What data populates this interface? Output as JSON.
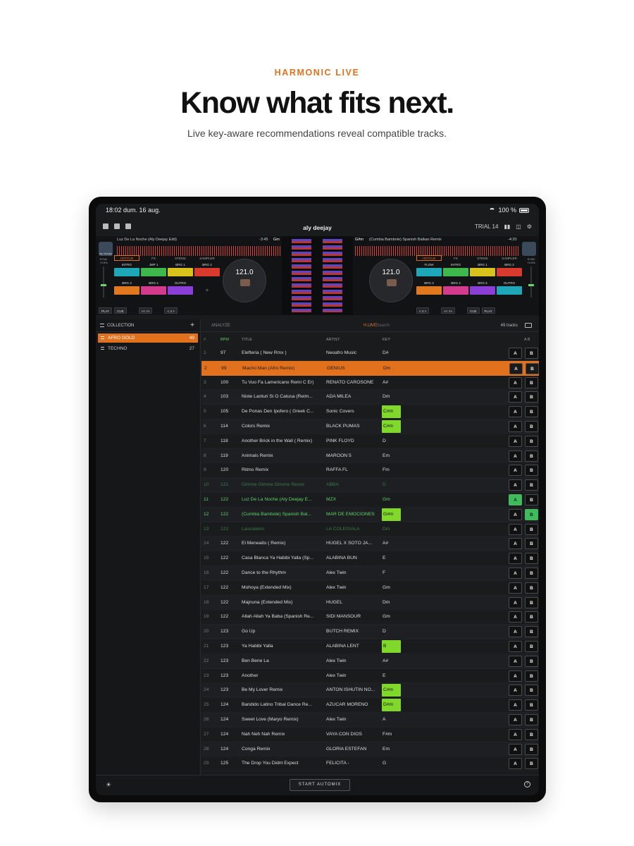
{
  "hero": {
    "eyebrow": "HARMONIC LIVE",
    "headline": "Know what fits next.",
    "subtitle": "Live key-aware recommendations reveal compatible tracks."
  },
  "status": {
    "time": "18:02",
    "date": "dum. 16 aug.",
    "battery": "100 %"
  },
  "app": {
    "logo": "aly deejay",
    "trial": "TRIAL 14"
  },
  "deck_left": {
    "track": "Luz De La Noche (Aly Deejay Edit)",
    "time": "-3:45",
    "key": "Gm",
    "bpm": "121.0",
    "pitch": "+0.0%",
    "tabs": [
      "HOTCUE",
      "FX",
      "STEMS",
      "SAMPLER"
    ],
    "pads": [
      {
        "label": "INTRO",
        "color": "#1ea7b8"
      },
      {
        "label": "JMP 1",
        "color": "#3fb84b"
      },
      {
        "label": "BRG 1",
        "color": "#d9c21c"
      },
      {
        "label": "BRG 2",
        "color": "#d93a2e"
      },
      {
        "label": "BRG 3",
        "color": "#e2781d"
      },
      {
        "label": "BRG 4",
        "color": "#d43a8d"
      },
      {
        "label": "OUTRO",
        "color": "#8b3fd6"
      }
    ],
    "controls": [
      "PLAY",
      "CUE",
      "<< >>",
      "< 4 >"
    ]
  },
  "deck_right": {
    "track": "(Cumbia Bambole) Spanish Balkan Remix",
    "time": "-4:20",
    "key": "G#m",
    "bpm": "121.0",
    "pitch": "+0.0%",
    "tabs": [
      "HOTCUE",
      "FX",
      "STEMS",
      "SAMPLER"
    ],
    "pads": [
      {
        "label": "FLOW",
        "color": "#1ea7b8"
      },
      {
        "label": "INTRO",
        "color": "#3fb84b"
      },
      {
        "label": "BRG 1",
        "color": "#d9c21c"
      },
      {
        "label": "BRG 2",
        "color": "#d93a2e"
      },
      {
        "label": "BRG 3",
        "color": "#e2781d"
      },
      {
        "label": "BRG 4",
        "color": "#d43a8d"
      },
      {
        "label": "BRG 5",
        "color": "#8b3fd6"
      },
      {
        "label": "OUTRO",
        "color": "#1ea7b8"
      }
    ],
    "controls": [
      "< 4 >",
      "<< >>",
      "CUE",
      "PLAY"
    ]
  },
  "sidebar": {
    "header": "COLLECTION",
    "crates": [
      {
        "name": "AFRO GOLD",
        "count": "49",
        "selected": true
      },
      {
        "name": "TECHNO",
        "count": "27",
        "selected": false
      }
    ]
  },
  "toolbar": {
    "analyze": "ANALYZE",
    "hlive": "H.LIVE",
    "search_placeholder": "Search",
    "count": "49 tracks"
  },
  "columns": {
    "num": "#",
    "bpm": "BPM",
    "title": "TITLE",
    "artist": "ARTIST",
    "key": "KEY",
    "ab": "A B"
  },
  "tracks": [
    {
      "n": "1",
      "bpm": "97",
      "title": "Elefteria ( New Rmx )",
      "artist": "Neoafro Music",
      "key": "D#"
    },
    {
      "n": "2",
      "bpm": "99",
      "title": "Macho Man (Afro Remix)",
      "artist": "GENIUS",
      "key": "Dm",
      "state": "sel"
    },
    {
      "n": "3",
      "bpm": "100",
      "title": "Tu Vuo Fa Lamericano Remi C Er)",
      "artist": "RENATO CAROSONE",
      "key": "A#"
    },
    {
      "n": "4",
      "bpm": "103",
      "title": "Niste Lanturi Si O Catusa (Reim...",
      "artist": "ADA MILEA",
      "key": "Dm"
    },
    {
      "n": "5",
      "bpm": "105",
      "title": "De Ponas Den Ipofero ( Greek C...",
      "artist": "Sonic Covers",
      "key": "C#m",
      "hl": true
    },
    {
      "n": "6",
      "bpm": "114",
      "title": "Colors Remix",
      "artist": "BLACK PUMAS",
      "key": "C#m",
      "hl": true
    },
    {
      "n": "7",
      "bpm": "118",
      "title": "Another Brick in the Wall ( Remix)",
      "artist": "PINK FLOYD",
      "key": "D"
    },
    {
      "n": "8",
      "bpm": "119",
      "title": "Animals Remix",
      "artist": "MAROON 5",
      "key": "Em"
    },
    {
      "n": "9",
      "bpm": "120",
      "title": "Ritmo Remix",
      "artist": "RAFFA FL",
      "key": "Fm"
    },
    {
      "n": "10",
      "bpm": "121",
      "title": "Gimme Gimme Gimme Remix",
      "artist": "ABBA",
      "key": "D",
      "state": "dim"
    },
    {
      "n": "11",
      "bpm": "122",
      "title": "Luz De La Noche (Aly Deejay E...",
      "artist": "MZX",
      "key": "Gm",
      "state": "green",
      "a": true
    },
    {
      "n": "12",
      "bpm": "122",
      "title": "(Cumbia Bambole) Spanish Bal...",
      "artist": "MAR DE EMOCIONES",
      "key": "G#m",
      "state": "green",
      "hl": true,
      "b": true
    },
    {
      "n": "13",
      "bpm": "122",
      "title": "Lasciatemi",
      "artist": "LA COLEGIALA",
      "key": "Dm",
      "state": "dim"
    },
    {
      "n": "14",
      "bpm": "122",
      "title": "El Meneaito ( Remix)",
      "artist": "HUGEL X SOTO JA...",
      "key": "A#"
    },
    {
      "n": "15",
      "bpm": "122",
      "title": "Casa Blanca Ya Habibi Yalla (Sp...",
      "artist": "ALABINA BUN",
      "key": "E"
    },
    {
      "n": "16",
      "bpm": "122",
      "title": "Dance to the Rhythm",
      "artist": "Alex Twin",
      "key": "F"
    },
    {
      "n": "17",
      "bpm": "122",
      "title": "Mohoya (Extended Mix)",
      "artist": "Alex Twin",
      "key": "Gm"
    },
    {
      "n": "18",
      "bpm": "122",
      "title": "Majnuna (Extended Mix)",
      "artist": "HUGEL",
      "key": "Dm"
    },
    {
      "n": "19",
      "bpm": "122",
      "title": "Allah Allah Ya Baba (Spanish Re...",
      "artist": "SIDI MANSOUR",
      "key": "Gm"
    },
    {
      "n": "20",
      "bpm": "123",
      "title": "Go Up",
      "artist": "BUTCH REMIX",
      "key": "D"
    },
    {
      "n": "21",
      "bpm": "123",
      "title": "Ya Habibi Yalla",
      "artist": "ALABINA LENT",
      "key": "B",
      "hl": true
    },
    {
      "n": "22",
      "bpm": "123",
      "title": "Ben Bene La",
      "artist": "Alex Twin",
      "key": "A#"
    },
    {
      "n": "23",
      "bpm": "123",
      "title": "Another",
      "artist": "Alex Twin",
      "key": "E"
    },
    {
      "n": "24",
      "bpm": "123",
      "title": "Be My Lover Remix",
      "artist": "ANTON ISHUTIN NO...",
      "key": "C#m",
      "hl": true
    },
    {
      "n": "25",
      "bpm": "124",
      "title": "Bandido Latino Tribal Dance Re...",
      "artist": "AZUCAR MORENO",
      "key": "D#m",
      "hl": true
    },
    {
      "n": "26",
      "bpm": "124",
      "title": "Sweet Love (Maryo Remix)",
      "artist": "Alex Twin",
      "key": "A"
    },
    {
      "n": "27",
      "bpm": "124",
      "title": "Nah Neh Nah Remix",
      "artist": "VAYA CON DIOS",
      "key": "F#m"
    },
    {
      "n": "28",
      "bpm": "124",
      "title": "Conga Remix",
      "artist": "GLORIA ESTEFAN",
      "key": "Em"
    },
    {
      "n": "29",
      "bpm": "125",
      "title": "The Drop You Didnt Expect",
      "artist": "FELICITA -",
      "key": "G"
    }
  ],
  "buttons": {
    "a": "A",
    "b": "B"
  },
  "bottom": {
    "automix": "START AUTOMIX"
  }
}
